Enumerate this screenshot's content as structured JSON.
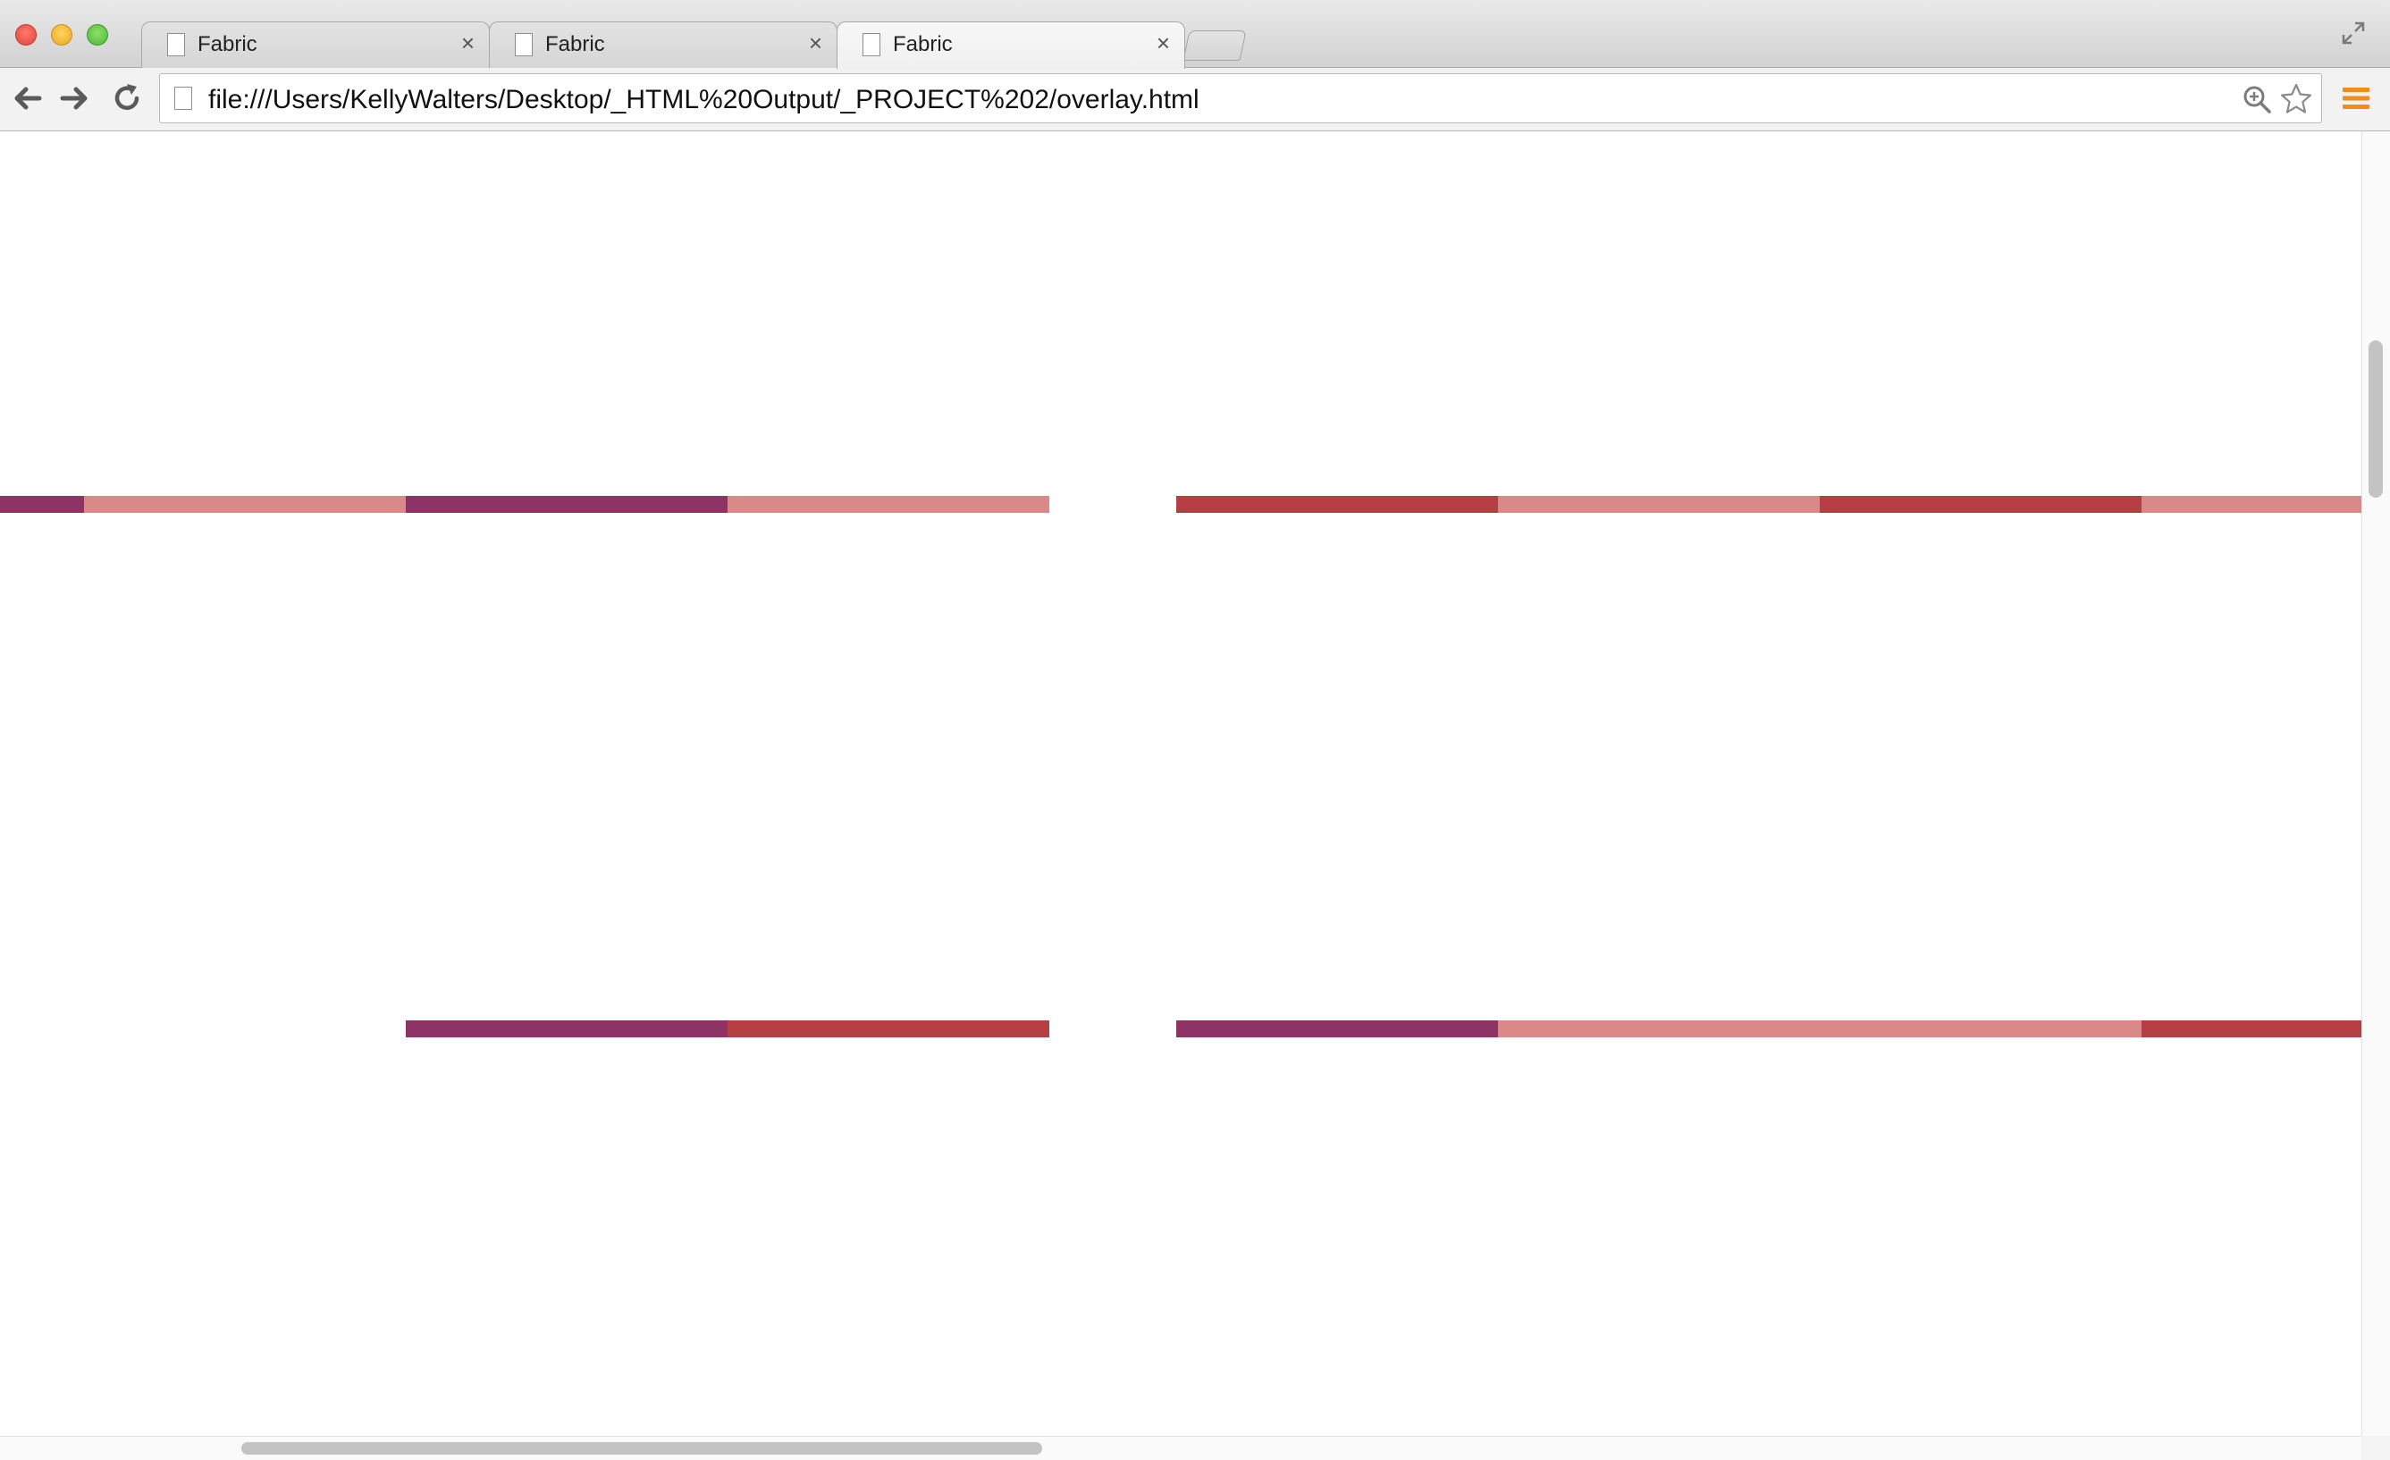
{
  "window": {
    "controls": [
      "close",
      "minimize",
      "zoom"
    ]
  },
  "tabs": [
    {
      "title": "Fabric",
      "close_symbol": "×",
      "active": false
    },
    {
      "title": "Fabric",
      "close_symbol": "×",
      "active": false
    },
    {
      "title": "Fabric",
      "close_symbol": "×",
      "active": true
    }
  ],
  "toolbar": {
    "url": "file:///Users/KellyWalters/Desktop/_HTML%20Output/_PROJECT%202/overlay.html",
    "icons": [
      "back-arrow-icon",
      "forward-arrow-icon",
      "reload-icon",
      "page-icon",
      "zoom-magnifier-icon",
      "bookmark-star-icon",
      "menu-icon"
    ]
  },
  "colors": {
    "plum": "#8e3366",
    "pink": "#d98a88",
    "red": "#b53f43"
  },
  "stripes": {
    "row_top": [
      {
        "color": "plum"
      },
      {
        "color": "pink"
      },
      {
        "color": "plum"
      },
      {
        "color": "pink"
      },
      {
        "color": "red"
      },
      {
        "color": "pink"
      },
      {
        "color": "red"
      },
      {
        "color": "pink"
      }
    ],
    "row_bottom": [
      {
        "color": "plum"
      },
      {
        "color": "red"
      },
      {
        "color": "plum"
      },
      {
        "color": "pink"
      },
      {
        "color": "red"
      }
    ]
  }
}
